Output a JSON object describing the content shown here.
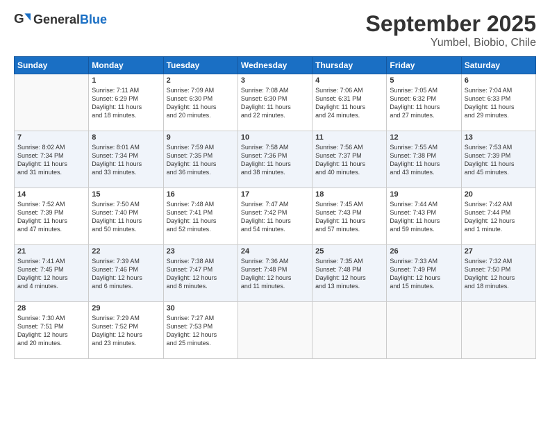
{
  "header": {
    "logo_general": "General",
    "logo_blue": "Blue",
    "month": "September 2025",
    "location": "Yumbel, Biobio, Chile"
  },
  "days_of_week": [
    "Sunday",
    "Monday",
    "Tuesday",
    "Wednesday",
    "Thursday",
    "Friday",
    "Saturday"
  ],
  "weeks": [
    [
      {
        "day": "",
        "info": ""
      },
      {
        "day": "1",
        "info": "Sunrise: 7:11 AM\nSunset: 6:29 PM\nDaylight: 11 hours\nand 18 minutes."
      },
      {
        "day": "2",
        "info": "Sunrise: 7:09 AM\nSunset: 6:30 PM\nDaylight: 11 hours\nand 20 minutes."
      },
      {
        "day": "3",
        "info": "Sunrise: 7:08 AM\nSunset: 6:30 PM\nDaylight: 11 hours\nand 22 minutes."
      },
      {
        "day": "4",
        "info": "Sunrise: 7:06 AM\nSunset: 6:31 PM\nDaylight: 11 hours\nand 24 minutes."
      },
      {
        "day": "5",
        "info": "Sunrise: 7:05 AM\nSunset: 6:32 PM\nDaylight: 11 hours\nand 27 minutes."
      },
      {
        "day": "6",
        "info": "Sunrise: 7:04 AM\nSunset: 6:33 PM\nDaylight: 11 hours\nand 29 minutes."
      }
    ],
    [
      {
        "day": "7",
        "info": "Sunrise: 8:02 AM\nSunset: 7:34 PM\nDaylight: 11 hours\nand 31 minutes."
      },
      {
        "day": "8",
        "info": "Sunrise: 8:01 AM\nSunset: 7:34 PM\nDaylight: 11 hours\nand 33 minutes."
      },
      {
        "day": "9",
        "info": "Sunrise: 7:59 AM\nSunset: 7:35 PM\nDaylight: 11 hours\nand 36 minutes."
      },
      {
        "day": "10",
        "info": "Sunrise: 7:58 AM\nSunset: 7:36 PM\nDaylight: 11 hours\nand 38 minutes."
      },
      {
        "day": "11",
        "info": "Sunrise: 7:56 AM\nSunset: 7:37 PM\nDaylight: 11 hours\nand 40 minutes."
      },
      {
        "day": "12",
        "info": "Sunrise: 7:55 AM\nSunset: 7:38 PM\nDaylight: 11 hours\nand 43 minutes."
      },
      {
        "day": "13",
        "info": "Sunrise: 7:53 AM\nSunset: 7:39 PM\nDaylight: 11 hours\nand 45 minutes."
      }
    ],
    [
      {
        "day": "14",
        "info": "Sunrise: 7:52 AM\nSunset: 7:39 PM\nDaylight: 11 hours\nand 47 minutes."
      },
      {
        "day": "15",
        "info": "Sunrise: 7:50 AM\nSunset: 7:40 PM\nDaylight: 11 hours\nand 50 minutes."
      },
      {
        "day": "16",
        "info": "Sunrise: 7:48 AM\nSunset: 7:41 PM\nDaylight: 11 hours\nand 52 minutes."
      },
      {
        "day": "17",
        "info": "Sunrise: 7:47 AM\nSunset: 7:42 PM\nDaylight: 11 hours\nand 54 minutes."
      },
      {
        "day": "18",
        "info": "Sunrise: 7:45 AM\nSunset: 7:43 PM\nDaylight: 11 hours\nand 57 minutes."
      },
      {
        "day": "19",
        "info": "Sunrise: 7:44 AM\nSunset: 7:43 PM\nDaylight: 11 hours\nand 59 minutes."
      },
      {
        "day": "20",
        "info": "Sunrise: 7:42 AM\nSunset: 7:44 PM\nDaylight: 12 hours\nand 1 minute."
      }
    ],
    [
      {
        "day": "21",
        "info": "Sunrise: 7:41 AM\nSunset: 7:45 PM\nDaylight: 12 hours\nand 4 minutes."
      },
      {
        "day": "22",
        "info": "Sunrise: 7:39 AM\nSunset: 7:46 PM\nDaylight: 12 hours\nand 6 minutes."
      },
      {
        "day": "23",
        "info": "Sunrise: 7:38 AM\nSunset: 7:47 PM\nDaylight: 12 hours\nand 8 minutes."
      },
      {
        "day": "24",
        "info": "Sunrise: 7:36 AM\nSunset: 7:48 PM\nDaylight: 12 hours\nand 11 minutes."
      },
      {
        "day": "25",
        "info": "Sunrise: 7:35 AM\nSunset: 7:48 PM\nDaylight: 12 hours\nand 13 minutes."
      },
      {
        "day": "26",
        "info": "Sunrise: 7:33 AM\nSunset: 7:49 PM\nDaylight: 12 hours\nand 15 minutes."
      },
      {
        "day": "27",
        "info": "Sunrise: 7:32 AM\nSunset: 7:50 PM\nDaylight: 12 hours\nand 18 minutes."
      }
    ],
    [
      {
        "day": "28",
        "info": "Sunrise: 7:30 AM\nSunset: 7:51 PM\nDaylight: 12 hours\nand 20 minutes."
      },
      {
        "day": "29",
        "info": "Sunrise: 7:29 AM\nSunset: 7:52 PM\nDaylight: 12 hours\nand 23 minutes."
      },
      {
        "day": "30",
        "info": "Sunrise: 7:27 AM\nSunset: 7:53 PM\nDaylight: 12 hours\nand 25 minutes."
      },
      {
        "day": "",
        "info": ""
      },
      {
        "day": "",
        "info": ""
      },
      {
        "day": "",
        "info": ""
      },
      {
        "day": "",
        "info": ""
      }
    ]
  ]
}
